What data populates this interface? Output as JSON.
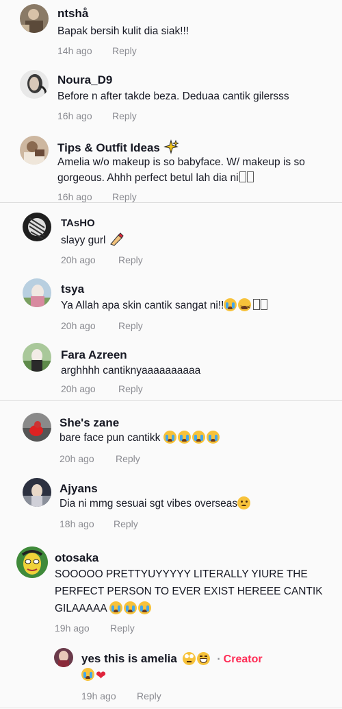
{
  "comments": [
    {
      "name": "ntshå",
      "text": "Bapak bersih kulit dia siak!!!",
      "time": "14h ago",
      "reply": "Reply"
    },
    {
      "name": "Noura_D9",
      "text": "Before n after takde beza. Deduaa cantik gilersss",
      "time": "16h ago",
      "reply": "Reply"
    },
    {
      "name": "Tips & Outfit Ideas",
      "text": "Amelia w/o makeup is so babyface. W/ makeup is so gorgeous. Ahhh perfect betul lah dia ni",
      "time": "16h ago",
      "reply": "Reply"
    },
    {
      "name": "TAsHO",
      "text": "slayy gurl",
      "time": "20h ago",
      "reply": "Reply"
    },
    {
      "name": "tsya",
      "text": "Ya Allah apa skin cantik sangat ni!!",
      "time": "20h ago",
      "reply": "Reply"
    },
    {
      "name": "Fara Azreen",
      "text": "arghhhh cantiknyaaaaaaaaaa",
      "time": "20h ago",
      "reply": "Reply"
    },
    {
      "name": "She's zane",
      "text": "bare face pun cantikk",
      "time": "20h ago",
      "reply": "Reply"
    },
    {
      "name": "Ajyans",
      "text": "Dia ni mmg sesuai sgt vibes overseas",
      "time": "18h ago",
      "reply": "Reply"
    },
    {
      "name": "otosaka",
      "text_line1": "SOOOOO PRETTYUYYYYY LITERALLY YIURE THE",
      "text_line2": "PERFECT PERSON TO EVER EXIST HEREEE CANTIK",
      "text_line3": "GILAAAAA",
      "time": "19h ago",
      "reply": "Reply"
    }
  ],
  "reply_comment": {
    "name": "yes this is amelia",
    "badge": "Creator",
    "separator": "·",
    "time": "19h ago",
    "reply": "Reply"
  },
  "colors": {
    "creator": "#fe2c55",
    "meta": "#8a8b91",
    "panel": "#fafafa",
    "divider": "#dcdcdc"
  },
  "icons": [
    "sparkles-icon",
    "nail-polish-icon",
    "loudly-crying-face-icon",
    "tired-face-icon",
    "frowning-face-icon",
    "face-with-rolling-eyes-icon",
    "grinning-face-icon",
    "red-heart-icon"
  ]
}
